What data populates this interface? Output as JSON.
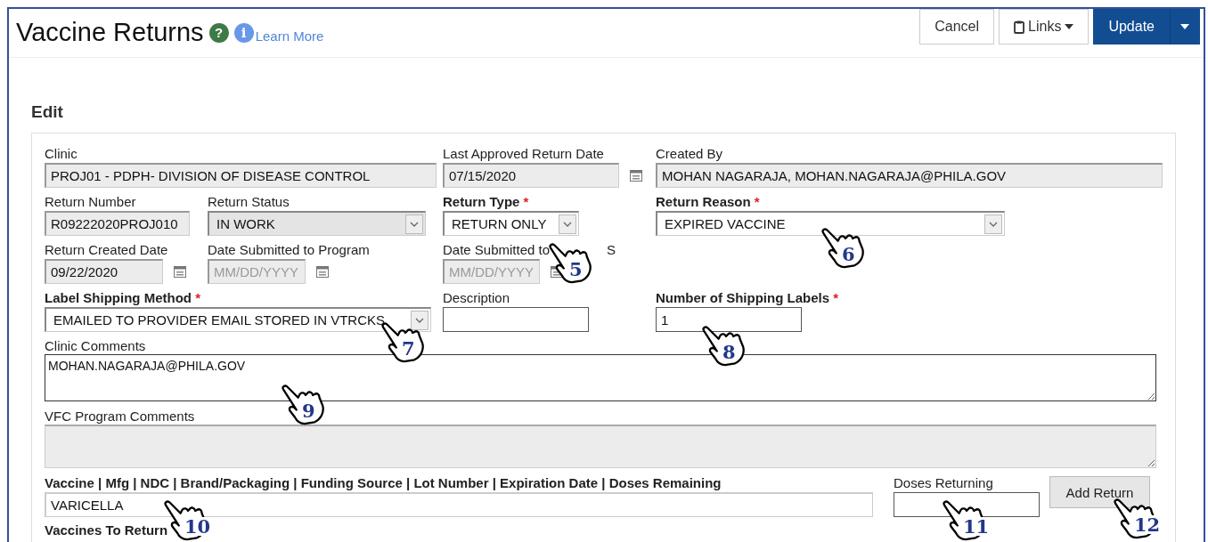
{
  "header": {
    "title": "Vaccine Returns",
    "help_glyph": "?",
    "info_glyph": "i",
    "learn_more": "Learn More",
    "buttons": [
      {
        "label": "Cancel",
        "kind": "plain"
      },
      {
        "label": "Links",
        "kind": "links"
      },
      {
        "label": "Update",
        "kind": "primary"
      }
    ]
  },
  "section_title": "Edit",
  "required_mark": "*",
  "rows": [
    [
      {
        "label": "Clinic",
        "kind": "text",
        "value": "PROJ01 - PDPH- DIVISION OF DISEASE CONTROL",
        "readonly": true,
        "required": false
      },
      {
        "label": "Last Approved Return Date",
        "kind": "date",
        "value": "07/15/2020",
        "readonly": true,
        "required": false
      },
      {
        "label": "Created By",
        "kind": "text",
        "value": "MOHAN NAGARAJA, MOHAN.NAGARAJA@PHILA.GOV",
        "readonly": true,
        "required": false
      }
    ],
    [
      {
        "label": "Return Number",
        "kind": "text",
        "value": "R09222020PROJ010",
        "readonly": true,
        "required": false
      },
      {
        "label": "Return Status",
        "kind": "select",
        "value": "IN WORK",
        "readonly": true,
        "required": false
      },
      {
        "label": "Return Type",
        "kind": "select",
        "value": "RETURN ONLY",
        "readonly": false,
        "required": true
      },
      {
        "label": "Return Reason",
        "kind": "select",
        "value": "EXPIRED VACCINE",
        "readonly": false,
        "required": true
      }
    ],
    [
      {
        "label": "Return Created Date",
        "kind": "date",
        "value": "09/22/2020",
        "readonly": true,
        "required": false
      },
      {
        "label": "Date Submitted to Program",
        "kind": "date",
        "placeholder": "MM/DD/YYYY",
        "readonly": true,
        "required": false
      },
      {
        "label": "Date Submitted to",
        "label_tail": "S",
        "kind": "date",
        "placeholder": "MM/DD/YYYY",
        "readonly": true,
        "required": false
      }
    ],
    [
      {
        "label": "Label Shipping Method",
        "kind": "select",
        "value": "EMAILED TO PROVIDER EMAIL STORED IN VTRCKS",
        "readonly": false,
        "required": true
      },
      {
        "label": "Description",
        "kind": "text",
        "readonly": false,
        "required": false
      },
      {
        "label": "Number of Shipping Labels",
        "kind": "text",
        "value": "1",
        "readonly": false,
        "required": true
      }
    ]
  ],
  "comments": [
    {
      "label": "Clinic Comments",
      "value": "MOHAN.NAGARAJA@PHILA.GOV",
      "readonly": false
    },
    {
      "label": "VFC Program Comments",
      "readonly": true
    }
  ],
  "vaccine": {
    "label": "Vaccine | Mfg | NDC | Brand/Packaging | Funding Source | Lot Number | Expiration Date | Doses Remaining",
    "value": "VARICELLA",
    "doses_label": "Doses Returning",
    "add_button": "Add Return",
    "list_title": "Vaccines To Return"
  },
  "callouts": [
    {
      "number": "5"
    },
    {
      "number": "6"
    },
    {
      "number": "7"
    },
    {
      "number": "8"
    },
    {
      "number": "9"
    },
    {
      "number": "10"
    },
    {
      "number": "11"
    },
    {
      "number": "12"
    }
  ]
}
